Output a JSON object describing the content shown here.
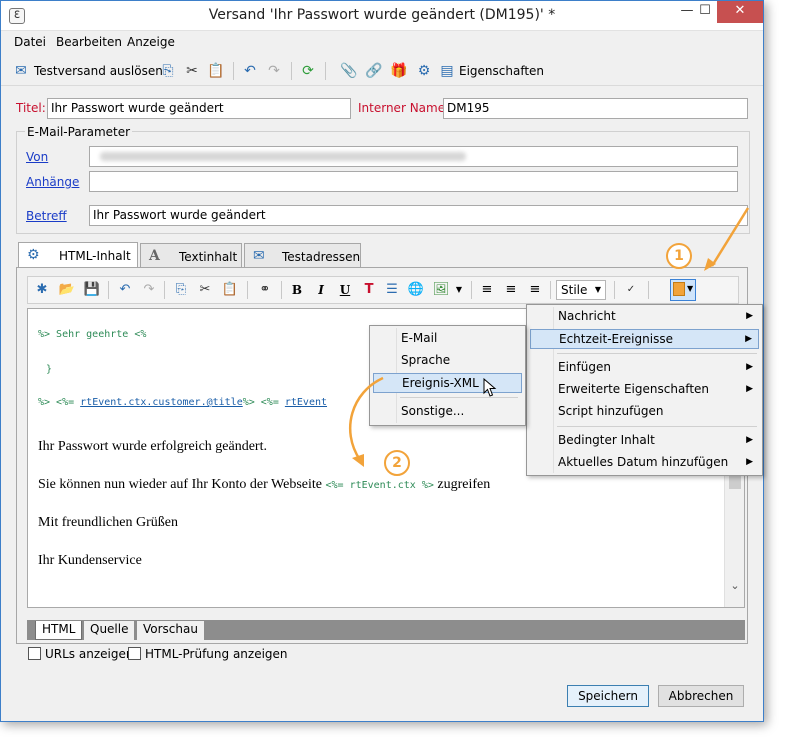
{
  "window": {
    "title": "Versand 'Ihr Passwort wurde geändert (DM195)' *",
    "minimize": "—",
    "maximize": "☐",
    "close": "✕"
  },
  "menubar": [
    "Datei",
    "Bearbeiten",
    "Anzeige"
  ],
  "toolbar": {
    "test_send": "Testversand auslösen",
    "properties": "Eigenschaften"
  },
  "form": {
    "title_label": "Titel:",
    "title_value": "Ihr Passwort wurde geändert",
    "internal_name_label": "Interner Name:",
    "internal_name_value": "DM195",
    "email_params_label": "E-Mail-Parameter",
    "from_label": "Von",
    "attachments_label": "Anhänge",
    "subject_label": "Betreff",
    "subject_value": "Ihr Passwort wurde geändert"
  },
  "tabs": [
    "HTML-Inhalt",
    "Textinhalt",
    "Testadressen"
  ],
  "editor_toolbar": {
    "bold": "B",
    "italic": "I",
    "underline": "U",
    "style_select": "Stile"
  },
  "editor": {
    "code_line1": "%> Sehr geehrte <%",
    "code_line2": "}",
    "code_line3_prefix": "%> <%= ",
    "code_line3_ref": "rtEvent.ctx.customer.@title",
    "code_line3_mid": "%> <%= ",
    "code_line3_ref2": "rtEvent",
    "para1": "Ihr Passwort wurde erfolgreich geändert.",
    "para2_before": "Sie können nun wieder auf Ihr Konto der Webseite ",
    "para2_code": "<%= rtEvent.ctx %>",
    "para2_after": " zugreifen",
    "para3": "Mit freundlichen Grüßen",
    "para4": "Ihr Kundenservice"
  },
  "bottom_tabs": [
    "HTML",
    "Quelle",
    "Vorschau"
  ],
  "checkboxes": {
    "show_urls": "URLs anzeigen",
    "html_check": "HTML-Prüfung anzeigen"
  },
  "buttons": {
    "save": "Speichern",
    "cancel": "Abbrechen"
  },
  "context_menu": {
    "items": [
      "Nachricht",
      "Echtzeit-Ereignisse",
      "Einfügen",
      "Erweiterte Eigenschaften",
      "Script hinzufügen",
      "Bedingter Inhalt",
      "Aktuelles Datum hinzufügen"
    ]
  },
  "submenu": {
    "items": [
      "E-Mail",
      "Sprache",
      "Ereignis-XML",
      "Sonstige..."
    ]
  },
  "callouts": [
    "1",
    "2"
  ],
  "colors": {
    "accent_orange": "#f2a33a",
    "highlight": "#d5e6f7",
    "required_red": "#c8102e",
    "link_blue": "#1a3cc7"
  }
}
